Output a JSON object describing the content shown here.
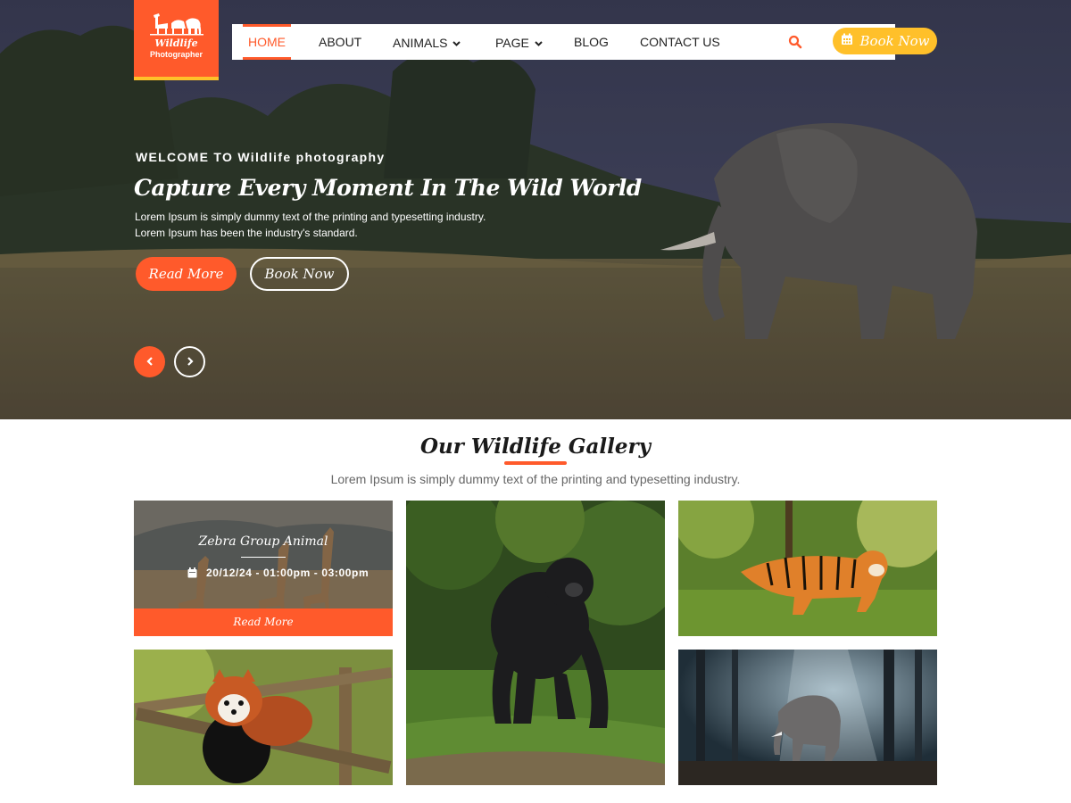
{
  "colors": {
    "accent": "#ff5a2b",
    "accent_secondary": "#ffc02a",
    "hero_overlay": "#2f3142"
  },
  "logo": {
    "title": "Wildlife",
    "subtitle": "Photographer",
    "icon": "animals-silhouette-icon"
  },
  "nav": {
    "items": [
      {
        "label": "HOME",
        "active": true
      },
      {
        "label": "ABOUT"
      },
      {
        "label": "ANIMALS",
        "dropdown": true
      },
      {
        "label": "PAGE",
        "dropdown": true
      },
      {
        "label": "BLOG"
      },
      {
        "label": "CONTACT US"
      }
    ],
    "search_icon": "search-icon",
    "book_button": {
      "label": "Book Now",
      "icon": "calendar-icon"
    }
  },
  "hero": {
    "welcome": "WELCOME TO Wildlife photography",
    "headline": "Capture Every Moment In The Wild World",
    "description_line1": "Lorem Ipsum is simply dummy text of the printing and typesetting industry.",
    "description_line2": "Lorem Ipsum has been the industry's standard.",
    "read_more": "Read More",
    "book_now": "Book Now",
    "prev_icon": "chevron-left-icon",
    "next_icon": "chevron-right-icon"
  },
  "gallery": {
    "title": "Our Wildlife Gallery",
    "subtitle": "Lorem Ipsum is simply dummy text of the printing and typesetting industry.",
    "featured": {
      "title": "Zebra Group Animal",
      "date": "20/12/24 - 01:00pm - 03:00pm",
      "read_more": "Read More",
      "date_icon": "calendar-icon",
      "read_more_icon": "chevron-right-icon"
    },
    "images": [
      "giraffes",
      "gorilla",
      "tiger",
      "red-panda",
      "elephant-in-forest"
    ]
  }
}
